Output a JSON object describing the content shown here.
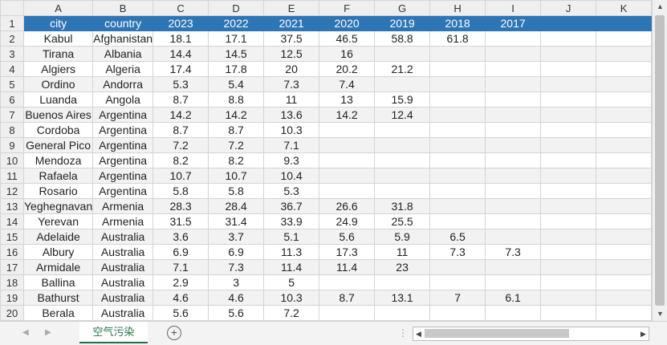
{
  "columns": [
    "A",
    "B",
    "C",
    "D",
    "E",
    "F",
    "G",
    "H",
    "I",
    "J",
    "K"
  ],
  "rows": [
    {
      "n": "1",
      "cells": [
        "city",
        "country",
        "2023",
        "2022",
        "2021",
        "2020",
        "2019",
        "2018",
        "2017",
        "",
        ""
      ]
    },
    {
      "n": "2",
      "cells": [
        "Kabul",
        "Afghanistan",
        "18.1",
        "17.1",
        "37.5",
        "46.5",
        "58.8",
        "61.8",
        "",
        "",
        ""
      ]
    },
    {
      "n": "3",
      "cells": [
        "Tirana",
        "Albania",
        "14.4",
        "14.5",
        "12.5",
        "16",
        "",
        "",
        "",
        "",
        ""
      ]
    },
    {
      "n": "4",
      "cells": [
        "Algiers",
        "Algeria",
        "17.4",
        "17.8",
        "20",
        "20.2",
        "21.2",
        "",
        "",
        "",
        ""
      ]
    },
    {
      "n": "5",
      "cells": [
        "Ordino",
        "Andorra",
        "5.3",
        "5.4",
        "7.3",
        "7.4",
        "",
        "",
        "",
        "",
        ""
      ]
    },
    {
      "n": "6",
      "cells": [
        "Luanda",
        "Angola",
        "8.7",
        "8.8",
        "11",
        "13",
        "15.9",
        "",
        "",
        "",
        ""
      ]
    },
    {
      "n": "7",
      "cells": [
        "Buenos Aires",
        "Argentina",
        "14.2",
        "14.2",
        "13.6",
        "14.2",
        "12.4",
        "",
        "",
        "",
        ""
      ]
    },
    {
      "n": "8",
      "cells": [
        "Cordoba",
        "Argentina",
        "8.7",
        "8.7",
        "10.3",
        "",
        "",
        "",
        "",
        "",
        ""
      ]
    },
    {
      "n": "9",
      "cells": [
        "General Pico",
        "Argentina",
        "7.2",
        "7.2",
        "7.1",
        "",
        "",
        "",
        "",
        "",
        ""
      ]
    },
    {
      "n": "10",
      "cells": [
        "Mendoza",
        "Argentina",
        "8.2",
        "8.2",
        "9.3",
        "",
        "",
        "",
        "",
        "",
        ""
      ]
    },
    {
      "n": "11",
      "cells": [
        "Rafaela",
        "Argentina",
        "10.7",
        "10.7",
        "10.4",
        "",
        "",
        "",
        "",
        "",
        ""
      ]
    },
    {
      "n": "12",
      "cells": [
        "Rosario",
        "Argentina",
        "5.8",
        "5.8",
        "5.3",
        "",
        "",
        "",
        "",
        "",
        ""
      ]
    },
    {
      "n": "13",
      "cells": [
        "Yeghegnavan",
        "Armenia",
        "28.3",
        "28.4",
        "36.7",
        "26.6",
        "31.8",
        "",
        "",
        "",
        ""
      ]
    },
    {
      "n": "14",
      "cells": [
        "Yerevan",
        "Armenia",
        "31.5",
        "31.4",
        "33.9",
        "24.9",
        "25.5",
        "",
        "",
        "",
        ""
      ]
    },
    {
      "n": "15",
      "cells": [
        "Adelaide",
        "Australia",
        "3.6",
        "3.7",
        "5.1",
        "5.6",
        "5.9",
        "6.5",
        "",
        "",
        ""
      ]
    },
    {
      "n": "16",
      "cells": [
        "Albury",
        "Australia",
        "6.9",
        "6.9",
        "11.3",
        "17.3",
        "11",
        "7.3",
        "7.3",
        "",
        ""
      ]
    },
    {
      "n": "17",
      "cells": [
        "Armidale",
        "Australia",
        "7.1",
        "7.3",
        "11.4",
        "11.4",
        "23",
        "",
        "",
        "",
        ""
      ]
    },
    {
      "n": "18",
      "cells": [
        "Ballina",
        "Australia",
        "2.9",
        "3",
        "5",
        "",
        "",
        "",
        "",
        "",
        ""
      ]
    },
    {
      "n": "19",
      "cells": [
        "Bathurst",
        "Australia",
        "4.6",
        "4.6",
        "10.3",
        "8.7",
        "13.1",
        "7",
        "6.1",
        "",
        ""
      ]
    },
    {
      "n": "20",
      "cells": [
        "Berala",
        "Australia",
        "5.6",
        "5.6",
        "7.2",
        "",
        "",
        "",
        "",
        "",
        ""
      ]
    }
  ],
  "sheet_tab": "空气污染",
  "add_sheet_symbol": "+",
  "colors": {
    "header_fill": "#2e75b6",
    "band_fill": "#f2f2f2",
    "tab_accent": "#217346"
  }
}
